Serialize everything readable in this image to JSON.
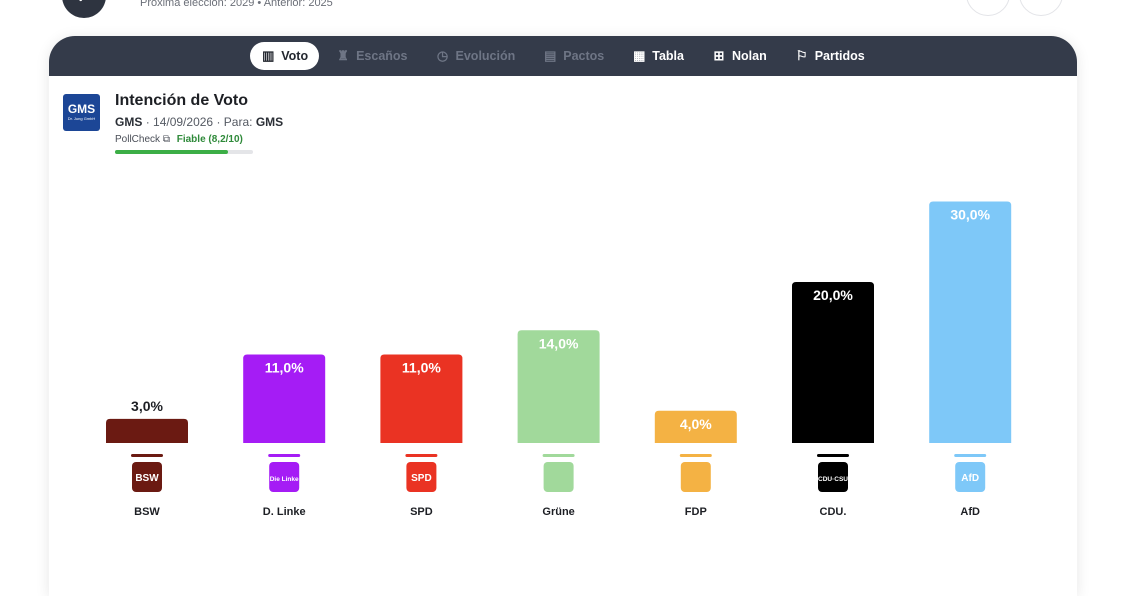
{
  "top": {
    "subtitle": "Próxima elección: 2029 • Anterior: 2025"
  },
  "tabs": [
    {
      "label": "Voto",
      "icon": "bar-chart-icon",
      "state": "active"
    },
    {
      "label": "Escaños",
      "icon": "seat-icon",
      "state": "disabled"
    },
    {
      "label": "Evolución",
      "icon": "history-icon",
      "state": "disabled"
    },
    {
      "label": "Pactos",
      "icon": "pacts-icon",
      "state": "disabled"
    },
    {
      "label": "Tabla",
      "icon": "table-icon",
      "state": "normal"
    },
    {
      "label": "Nolan",
      "icon": "nolan-icon",
      "state": "normal"
    },
    {
      "label": "Partidos",
      "icon": "flag-icon",
      "state": "normal"
    }
  ],
  "poll": {
    "logo_text": "GMS",
    "logo_sub": "Dr. Jung GmbH",
    "title": "Intención de Voto",
    "pollster": "GMS",
    "date": "14/09/2026",
    "para_label": "Para:",
    "para_value": "GMS",
    "pollcheck_label": "PollCheck",
    "rating": "Fiable (8,2/10)",
    "rating_value": 8.2,
    "rating_max": 10
  },
  "chart_data": {
    "type": "bar",
    "categories": [
      "BSW",
      "D. Linke",
      "SPD",
      "Grüne",
      "FDP",
      "CDU.",
      "AfD"
    ],
    "values": [
      3.0,
      11.0,
      11.0,
      14.0,
      4.0,
      20.0,
      30.0
    ],
    "value_labels": [
      "3,0%",
      "11,0%",
      "11,0%",
      "14,0%",
      "4,0%",
      "20,0%",
      "30,0%"
    ],
    "logo_texts": [
      "BSW",
      "Die Linke",
      "SPD",
      "",
      "",
      "CDU·CSU",
      "AfD"
    ],
    "colors": [
      "#6b1a12",
      "#a51cf5",
      "#ea3323",
      "#a1d99b",
      "#f4b244",
      "#000000",
      "#7ec8f8"
    ],
    "label_colors": [
      "#1d1f24",
      "#ffffff",
      "#ffffff",
      "#ffffff",
      "#ffffff",
      "#ffffff",
      "#ffffff"
    ],
    "ylim": [
      0,
      30
    ],
    "title": "Intención de Voto"
  },
  "colors": {
    "tabbar": "#343b4a",
    "pollcheck_green": "#3cae46"
  }
}
